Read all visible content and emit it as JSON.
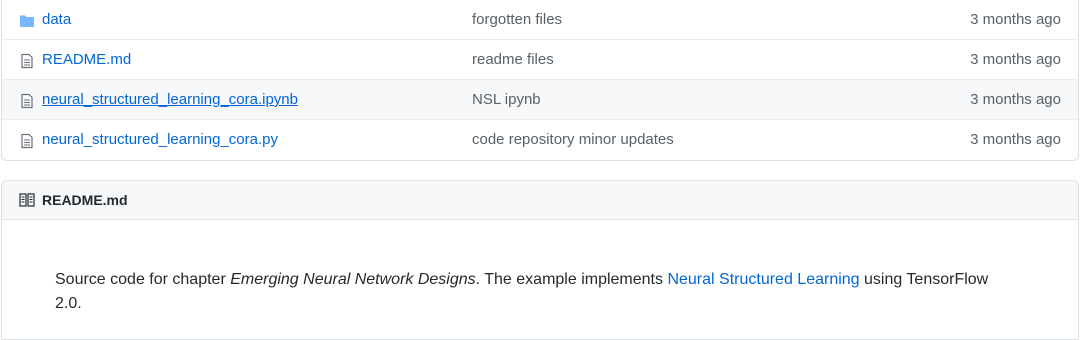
{
  "files": [
    {
      "type": "folder",
      "icon": "folder-icon",
      "name": "data",
      "message": "forgotten files",
      "age": "3 months ago"
    },
    {
      "type": "file",
      "icon": "file-icon",
      "name": "README.md",
      "message": "readme files",
      "age": "3 months ago"
    },
    {
      "type": "file",
      "icon": "file-icon",
      "name": "neural_structured_learning_cora.ipynb",
      "message": "NSL ipynb",
      "age": "3 months ago",
      "hovered": true
    },
    {
      "type": "file",
      "icon": "file-icon",
      "name": "neural_structured_learning_cora.py",
      "message": "code repository minor updates",
      "age": "3 months ago"
    }
  ],
  "readme": {
    "header_icon": "book-icon",
    "title": "README.md",
    "text_before": "Source code for chapter ",
    "text_emphasis": "Emerging Neural Network Designs",
    "text_middle": ". The example implements ",
    "link_text": "Neural Structured Learning",
    "text_after": " using TensorFlow 2.0."
  },
  "colors": {
    "link": "#0366d6",
    "folder_icon": "#79b8ff",
    "file_icon": "#6a737d"
  }
}
